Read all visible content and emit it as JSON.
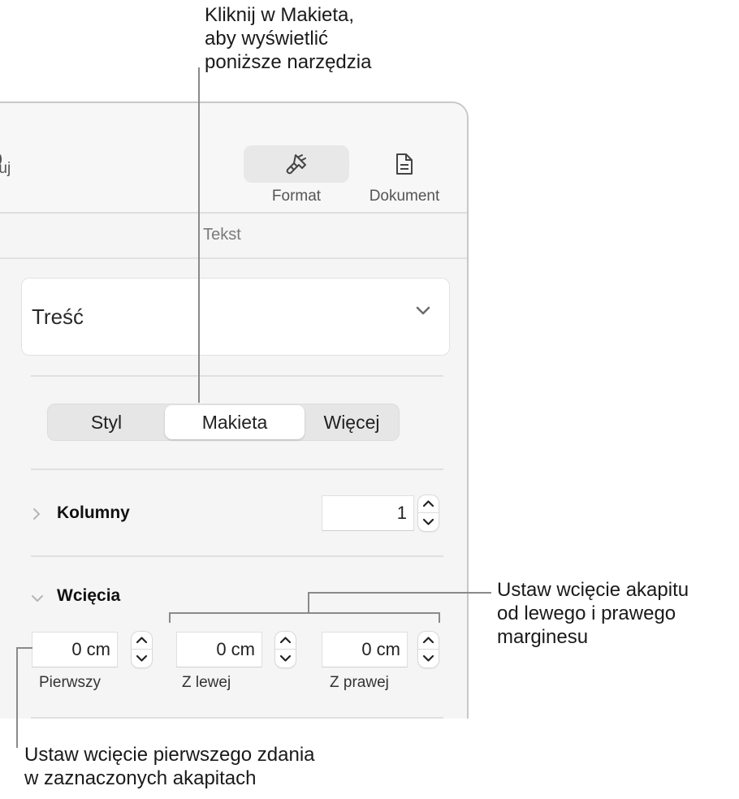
{
  "callouts": {
    "top": "Kliknij w Makieta,\naby wyświetlić\nponiższe narzędzia",
    "right": "Ustaw wcięcie akapitu\nod lewego i prawego\nmarginesu",
    "bottom": "Ustaw wcięcie pierwszego zdania\nw zaznaczonych akapitach"
  },
  "toolbar": {
    "left_fragment_label": "racuj",
    "buttons": [
      {
        "label": "Format",
        "icon": "paintbrush-icon",
        "active": true
      },
      {
        "label": "Dokument",
        "icon": "document-icon",
        "active": false
      }
    ]
  },
  "section_header": "Tekst",
  "paragraph_style": {
    "value": "Treść"
  },
  "tabs": [
    {
      "label": "Styl",
      "active": false
    },
    {
      "label": "Makieta",
      "active": true
    },
    {
      "label": "Więcej",
      "active": false
    }
  ],
  "columns": {
    "label": "Kolumny",
    "expanded": false,
    "value": "1"
  },
  "indents": {
    "label": "Wcięcia",
    "expanded": true,
    "fields": [
      {
        "label": "Pierwszy",
        "value": "0 cm"
      },
      {
        "label": "Z lewej",
        "value": "0 cm"
      },
      {
        "label": "Z prawej",
        "value": "0 cm"
      }
    ]
  }
}
